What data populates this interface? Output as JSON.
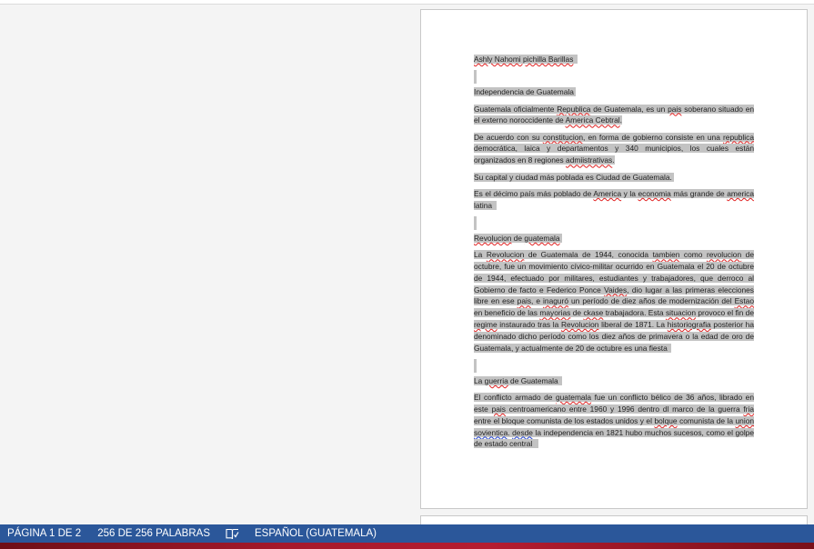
{
  "document": {
    "author": "Ashly Nahomi pichilla Barillas",
    "heading1": "Independencia de Guatemala",
    "para1": {
      "t1": "Guatemala oficialmente ",
      "w1": "Republica",
      "t2": " de Guatemala, es un ",
      "w2": "pais",
      "t3": " soberano situado en el externo noroccidente de ",
      "w3": "America Cebtral",
      "t4": "."
    },
    "para2": {
      "t1": "De acuerdo con su ",
      "w1": "constitucion",
      "t2": ", en forma de gobierno consiste en una ",
      "w2": "republica",
      "t3": " democrática, laica y departamentos y 340 municipios, los cuales están organizados en 8 regiones ",
      "w3": "admiistrativas",
      "t4": "."
    },
    "para3": "Su capital y ciudad más poblada es Ciudad de Guatemala.",
    "para4": {
      "t1": "Es el décimo país más poblado de ",
      "w1": "America",
      "t2": " y la ",
      "w2": "economia",
      "t3": " más grande de ",
      "w3": "america",
      "t4": " latina"
    },
    "heading2": {
      "w1": "Revolucion",
      "t1": " de ",
      "w2": "guatemala"
    },
    "para5": {
      "t1": "La ",
      "w1": "Revolucion",
      "t2": " de Guatemala de 1944, conocida ",
      "w2": "tambien",
      "t3": " como ",
      "w3": "revolucion",
      "t4": " de octubre, fue un movimiento cívico-militar ocurrido en Guatemala el 20 de octubre de 1944, efectuado por militares, estudiantes y trabajadores, que derroco al Gobierno de facto e Federico Ponce ",
      "w4": "Vaides",
      "t5": ", dio lugar a las primeras elecciones libre en ese ",
      "w5": "pais",
      "t6": ", e ",
      "w6": "inaguró",
      "t7": " un período de diez años de modernización del ",
      "w7": "Estao",
      "t8": " en beneficio de las ",
      "w8": "mayorias",
      "t9": " de ",
      "w9": "ckase",
      "t10": " trabajadora. Esta ",
      "w10": "situacion",
      "t11": " provoco el fin de ",
      "w11": "regime",
      "t12": " instaurado tras la ",
      "w12": "Revolucion",
      "t13": " liberal de 1871. La ",
      "w13": "historiografia",
      "t14": " posterior ha denominado dicho período como los diez años de primavera o la edad de oro de Guatemala, y actualmente de 20 de octubre es una fiesta"
    },
    "heading3": {
      "t1": "La ",
      "w1": "guerria",
      "t2": " de Guatemala"
    },
    "para6": {
      "t1": "El conflicto armado de ",
      "w1": "guatemala",
      "t2": " fue un conflicto bélico de 36 años, librado en este ",
      "w2": "pais",
      "t3": " centroamericano entre 1960 y 1996 dentro dl marco de la guerra ",
      "w3": "fria",
      "t4": " entre el bloque comunista de los estados unidos y el  ",
      "w4": "bolque",
      "t5": " comunista de la ",
      "w5": "union",
      "t6": " ",
      "w6": "sovientica",
      "t7": ".  ",
      "w7": "desde",
      "t8": " la independencia en 1821 hubo muchos sucesos, como el golpe de estado central"
    }
  },
  "statusbar": {
    "page": "PÁGINA 1 DE 2",
    "words": "256 DE 256 PALABRAS",
    "proof_icon": "proofing-book-icon",
    "language": "ESPAÑOL (GUATEMALA)"
  },
  "colors": {
    "statusbar_bg": "#2b579a",
    "selection": "#c3c3c3",
    "spell_error": "#e02020",
    "grammar_error": "#2040d0"
  }
}
